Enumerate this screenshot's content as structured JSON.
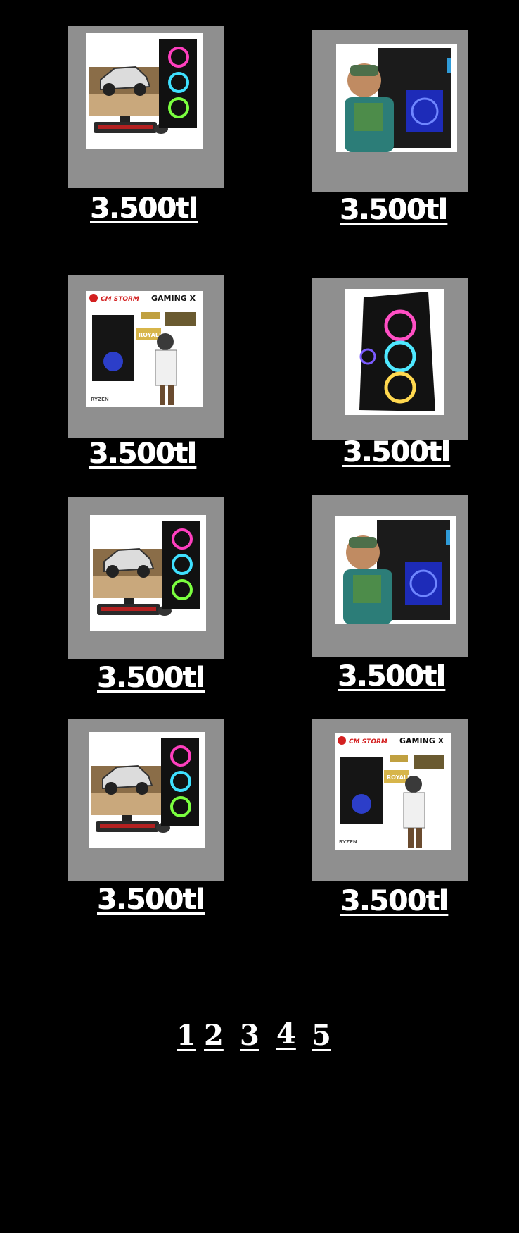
{
  "products": [
    {
      "image": "rally-car-gaming-pc-set",
      "price": "3.500tl"
    },
    {
      "image": "soldier-gaming-case",
      "price": "3.500tl"
    },
    {
      "image": "cm-storm-gaming-x-pubg-poster",
      "price": "3.500tl"
    },
    {
      "image": "rgb-fan-tower-case",
      "price": "3.500tl"
    },
    {
      "image": "rally-car-gaming-pc-set",
      "price": "3.500tl"
    },
    {
      "image": "soldier-gaming-case",
      "price": "3.500tl"
    },
    {
      "image": "rally-car-gaming-pc-set",
      "price": "3.500tl"
    },
    {
      "image": "cm-storm-gaming-x-pubg-poster",
      "price": "3.500tl"
    }
  ],
  "poster": {
    "brand": "CM STORM",
    "title": "GAMING X",
    "badge": "ROYALE",
    "cpu": "RYZEN"
  },
  "pagination": [
    "1",
    "2",
    "3",
    "4",
    "5"
  ],
  "colors": {
    "background": "#000000",
    "card": "#8f8f8f",
    "text": "#ffffff"
  }
}
